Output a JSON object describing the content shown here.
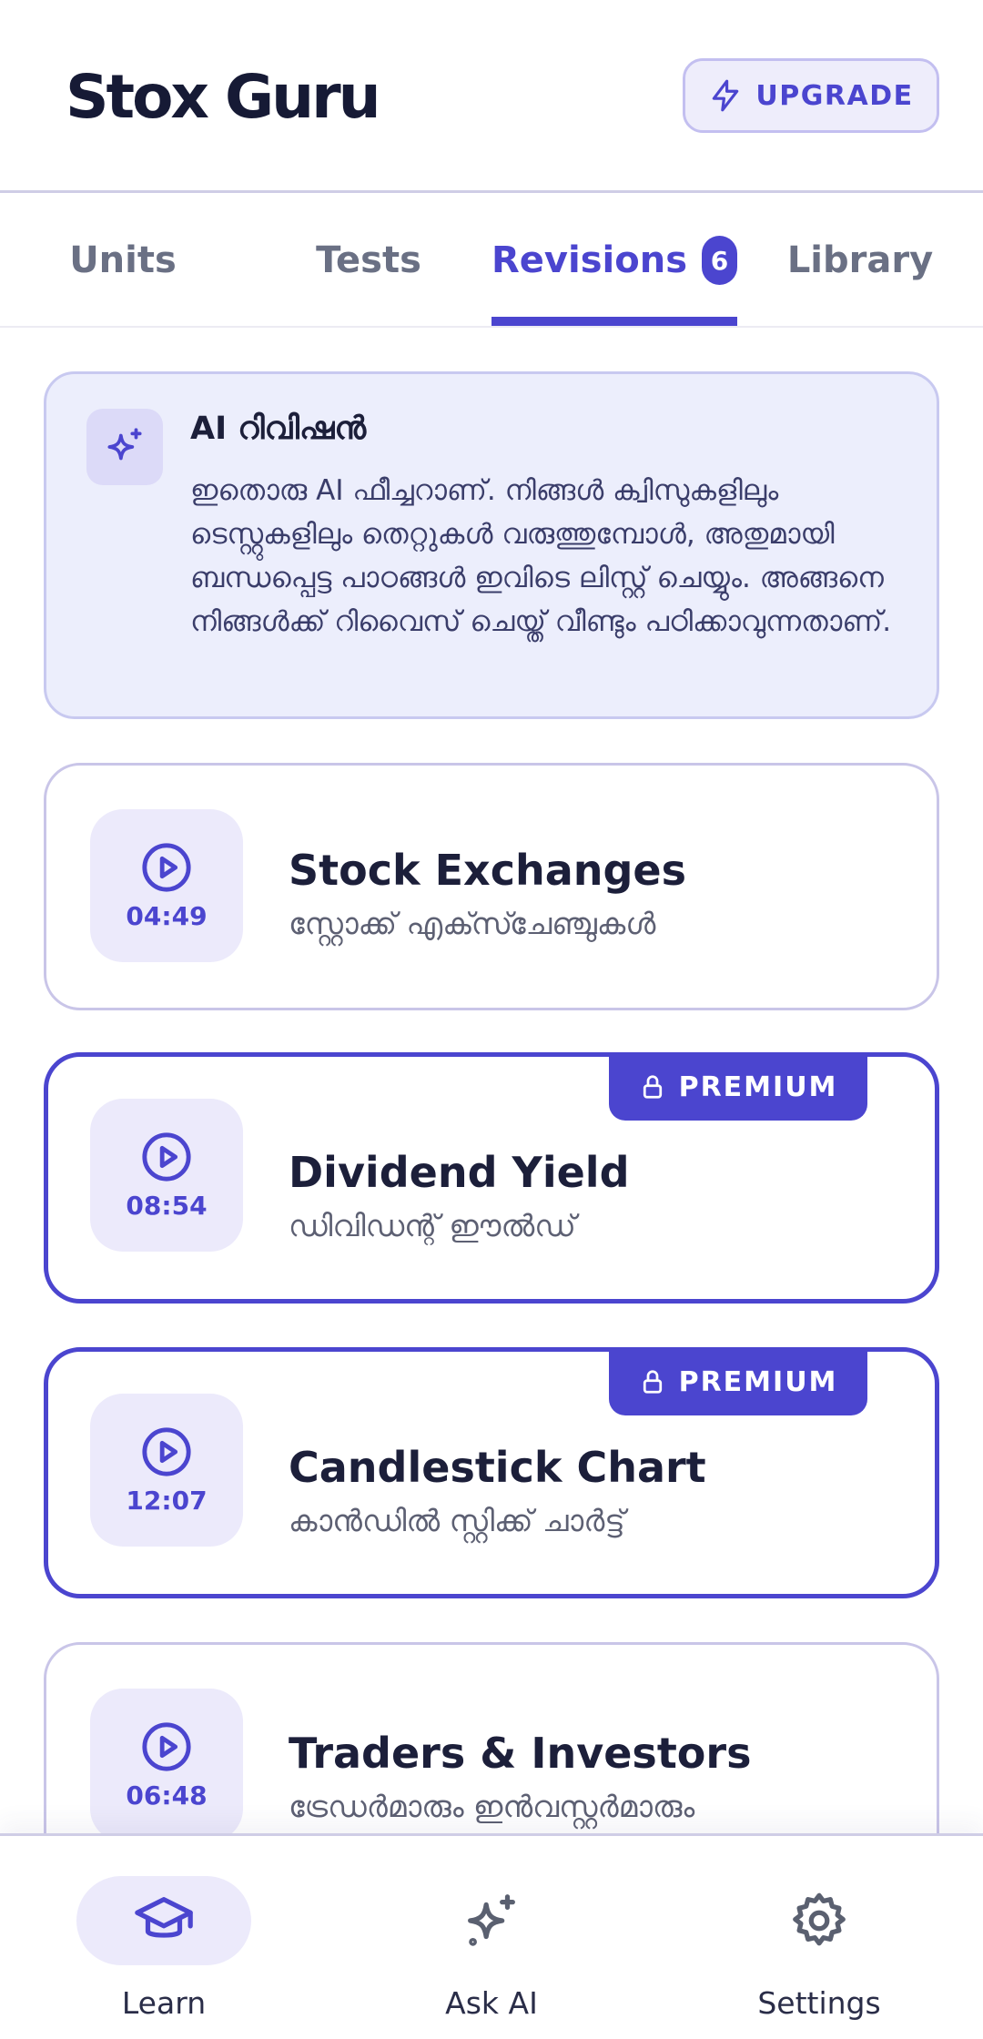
{
  "header": {
    "title": "Stox Guru",
    "upgrade_label": "UPGRADE",
    "upgrade_icon": "lightning-icon"
  },
  "tabs": [
    {
      "label": "Units",
      "active": false
    },
    {
      "label": "Tests",
      "active": false
    },
    {
      "label": "Revisions",
      "active": true,
      "badge": "6"
    },
    {
      "label": "Library",
      "active": false
    }
  ],
  "ai_card": {
    "icon": "sparkle-icon",
    "title": "AI റിവിഷൻ",
    "body": "ഇതൊരു AI ഫീച്ചറാണ്. നിങ്ങൾ ക്വിസുകളിലും ടെസ്റ്റുകളിലും തെറ്റുകൾ വരുത്തുമ്പോൾ, അതുമായി ബന്ധപ്പെട്ട പാഠങ്ങൾ ഇവിടെ ലിസ്റ്റ് ചെയ്യും. അങ്ങനെ നിങ്ങൾക്ക് റിവൈസ് ചെയ്ത് വീണ്ടും പഠിക്കാവുന്നതാണ്."
  },
  "lessons": [
    {
      "duration": "04:49",
      "title": "Stock Exchanges",
      "subtitle": "സ്റ്റോക്ക് എക്സ്ചേഞ്ചുകൾ",
      "premium": false
    },
    {
      "duration": "08:54",
      "title": "Dividend Yield",
      "subtitle": "ഡിവിഡന്റ് ഈൽഡ്",
      "premium": true,
      "badge": "PREMIUM"
    },
    {
      "duration": "12:07",
      "title": "Candlestick Chart",
      "subtitle": "കാൻഡിൽ സ്റ്റിക്ക് ചാർട്ട്",
      "premium": true,
      "badge": "PREMIUM"
    },
    {
      "duration": "06:48",
      "title": "Traders & Investors",
      "subtitle": "ട്രേഡർമാരും ഇൻവസ്റ്റർമാരും",
      "premium": false
    }
  ],
  "bottom_nav": [
    {
      "label": "Learn",
      "icon": "graduation-cap-icon",
      "active": true
    },
    {
      "label": "Ask AI",
      "icon": "sparkle-icon",
      "active": false
    },
    {
      "label": "Settings",
      "icon": "gear-icon",
      "active": false
    }
  ],
  "colors": {
    "accent": "#4b45cf",
    "accent_light": "#eceafb",
    "text_dark": "#1c1f3a",
    "text_muted": "#6a7084"
  }
}
